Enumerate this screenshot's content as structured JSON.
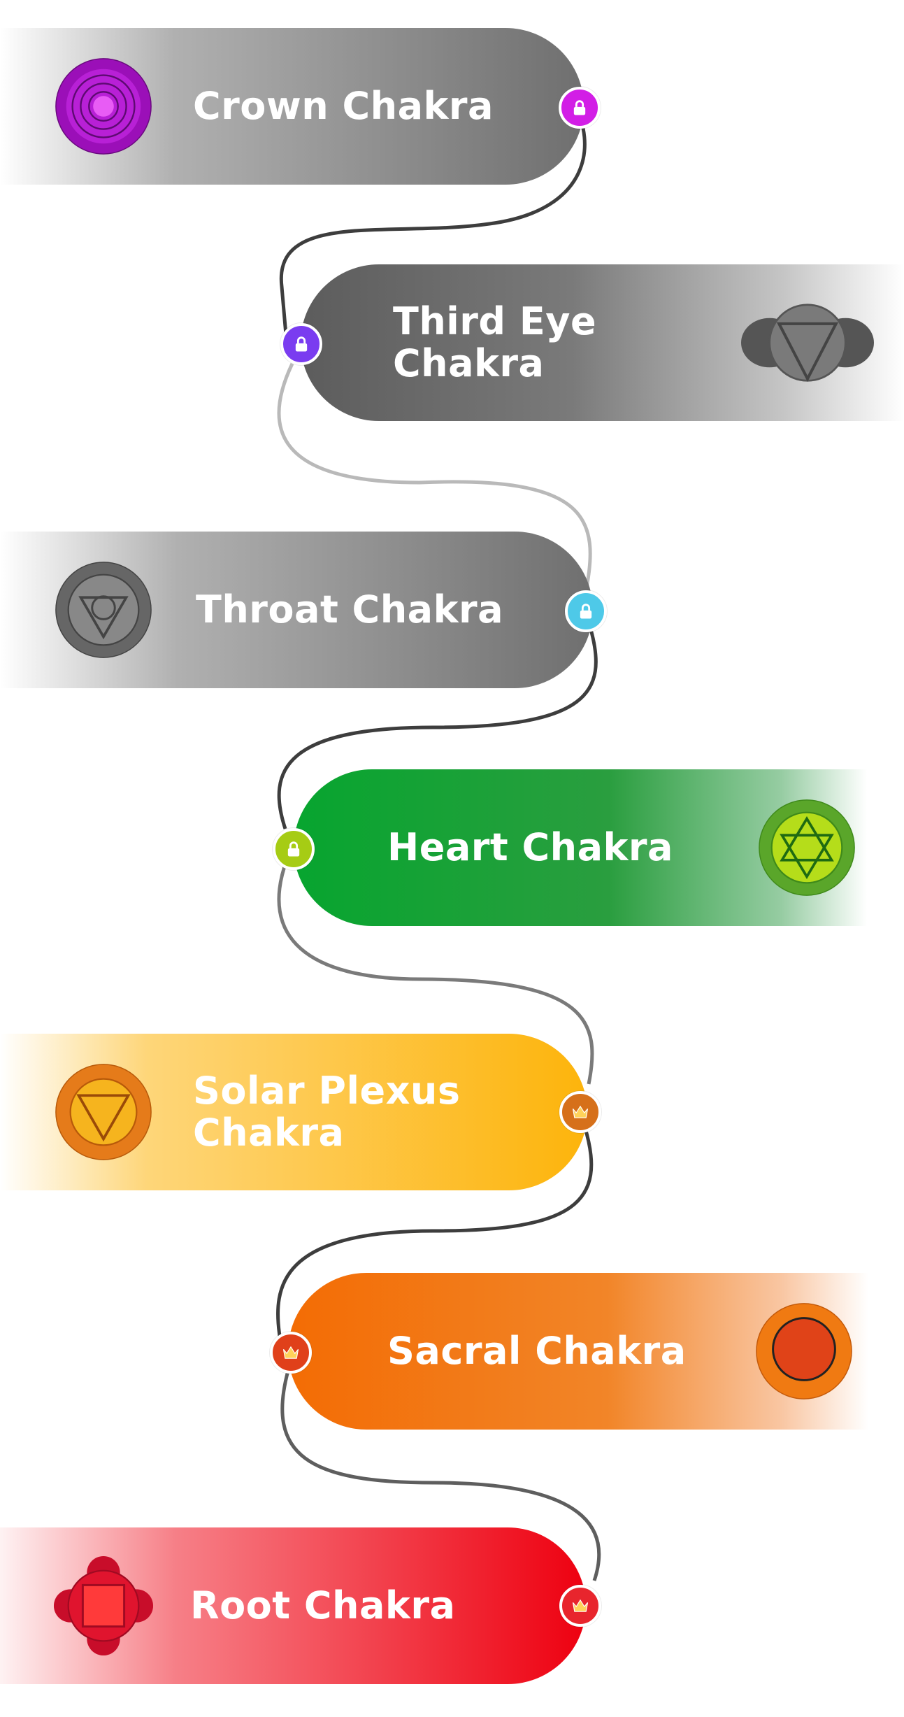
{
  "chakras": [
    {
      "name": "Crown Chakra",
      "badge": "lock-icon",
      "badge_color": "#d21ee6",
      "symbol": "crown-chakra-icon"
    },
    {
      "name": "Third Eye Chakra",
      "badge": "lock-icon",
      "badge_color": "#7a3cf0",
      "symbol": "third-eye-chakra-icon"
    },
    {
      "name": "Throat Chakra",
      "badge": "lock-icon",
      "badge_color": "#4ec9e8",
      "symbol": "throat-chakra-icon"
    },
    {
      "name": "Heart Chakra",
      "badge": "lock-icon",
      "badge_color": "#a6cc14",
      "symbol": "heart-chakra-icon"
    },
    {
      "name": "Solar Plexus Chakra",
      "badge": "crown-icon",
      "badge_color": "#d6701a",
      "symbol": "solar-plexus-chakra-icon"
    },
    {
      "name": "Sacral Chakra",
      "badge": "crown-icon",
      "badge_color": "#e0401a",
      "symbol": "sacral-chakra-icon"
    },
    {
      "name": "Root Chakra",
      "badge": "crown-icon",
      "badge_color": "#e8252d",
      "symbol": "root-chakra-icon"
    }
  ],
  "colors": {
    "locked_card": "#6f6f6f",
    "heart": "#07a52f",
    "solar_plexus": "#fdb40b",
    "sacral": "#f36c04",
    "root": "#ee0010"
  }
}
